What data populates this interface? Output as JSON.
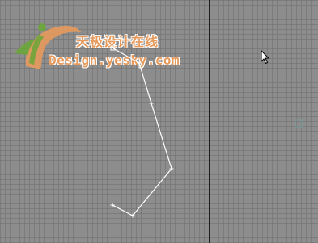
{
  "watermark": {
    "cn_text": "天极设计在线",
    "en_text": "Design.yesky.com"
  },
  "viewport": {
    "grid_color": "#6e6e6e",
    "axis_color": "#1e1e1e",
    "spline_color": "#ffffff",
    "watermark_color": "#e69a5c",
    "watermark_green": "#6aa63a"
  },
  "icons": [
    "mouse-cursor-icon",
    "axis-gizmo-icon"
  ]
}
